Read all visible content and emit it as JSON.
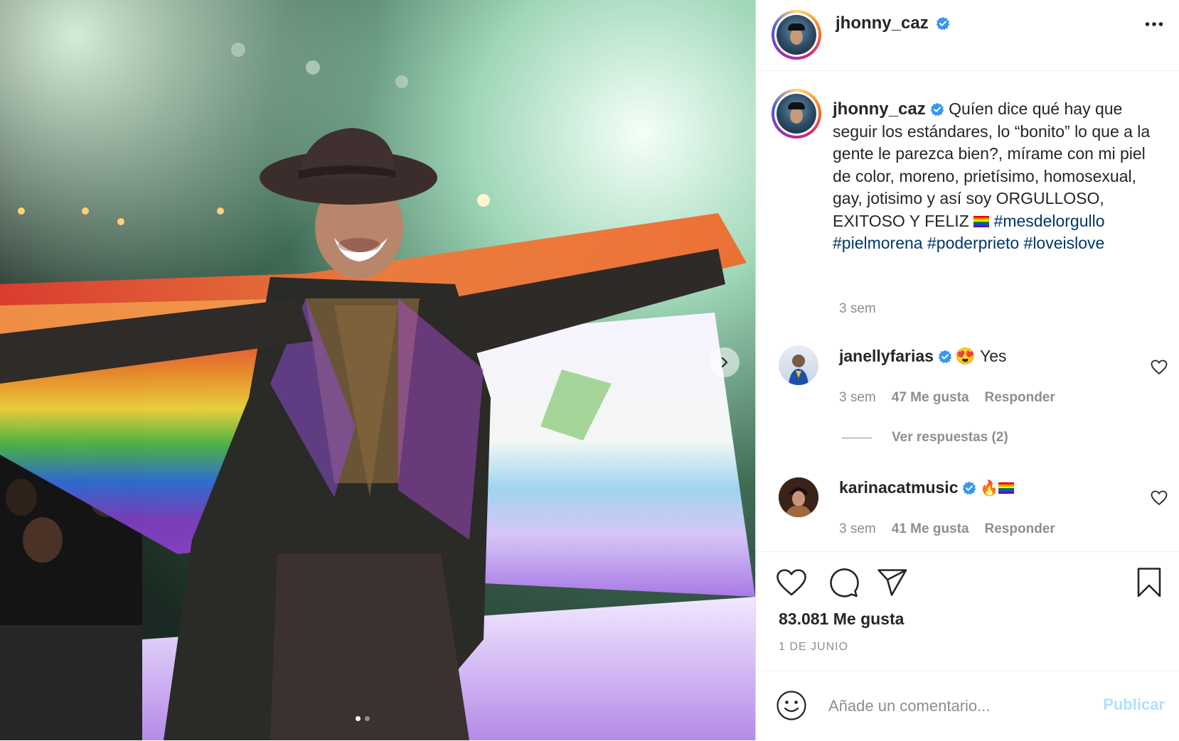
{
  "post": {
    "username": "jhonny_caz",
    "caption_text": "Quíen dice qué hay que seguir los estándares, lo “bonito” lo que a la gente le parezca bien?, mírame con mi piel de color, moreno, prietísimo, homosexual, gay, jotisimo y así soy ORGULLOSO, EXITOSO Y FELIZ",
    "caption_emoji": "rainbow-flag",
    "hashtags": [
      "#mesdelorgullo",
      "#pielmorena",
      "#poderprieto",
      "#loveislove"
    ],
    "time": "3 sem",
    "likes": "83.081 Me gusta",
    "date": "1 DE JUNIO"
  },
  "comments": [
    {
      "username": "janellyfarias",
      "text": "😍 Yes",
      "time": "3 sem",
      "likes": "47 Me gusta",
      "reply_label": "Responder",
      "view_replies": "Ver respuestas (2)"
    },
    {
      "username": "karinacatmusic",
      "text": "🔥",
      "emoji": "rainbow-flag",
      "time": "3 sem",
      "likes": "41 Me gusta",
      "reply_label": "Responder"
    }
  ],
  "add_comment": {
    "placeholder": "Añade un comentario...",
    "publish_label": "Publicar"
  },
  "carousel": {
    "total_slides": 2,
    "active_slide": 1
  },
  "colors": {
    "verified": "#3897f0",
    "link": "#00376b",
    "muted": "#8e8e8e",
    "publish_disabled": "#b2dffc"
  }
}
